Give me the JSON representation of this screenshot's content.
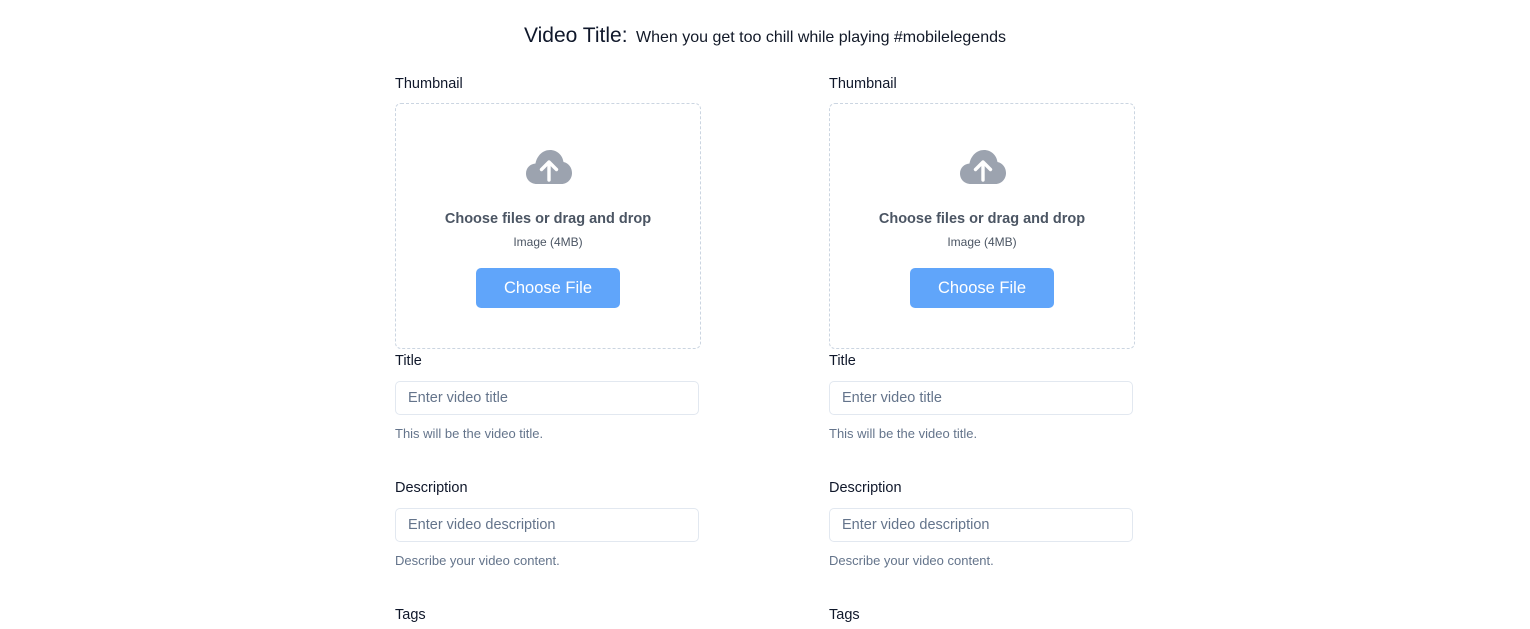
{
  "header": {
    "label": "Video Title:",
    "value": "When you get too chill while playing #mobilelegends"
  },
  "forms": [
    {
      "thumbnail_label": "Thumbnail",
      "dropzone": {
        "icon": "cloud-upload-icon",
        "main_text": "Choose files or drag and drop",
        "sub_text": "Image (4MB)",
        "button_label": "Choose File"
      },
      "title_label": "Title",
      "title_placeholder": "Enter video title",
      "title_helper": "This will be the video title.",
      "description_label": "Description",
      "description_placeholder": "Enter video description",
      "description_helper": "Describe your video content.",
      "tags_label": "Tags"
    },
    {
      "thumbnail_label": "Thumbnail",
      "dropzone": {
        "icon": "cloud-upload-icon",
        "main_text": "Choose files or drag and drop",
        "sub_text": "Image (4MB)",
        "button_label": "Choose File"
      },
      "title_label": "Title",
      "title_placeholder": "Enter video title",
      "title_helper": "This will be the video title.",
      "description_label": "Description",
      "description_placeholder": "Enter video description",
      "description_helper": "Describe your video content.",
      "tags_label": "Tags"
    }
  ],
  "colors": {
    "button_bg": "#60a5fa",
    "icon_gray": "#9ca3af",
    "border": "#e2e8f0",
    "helper_text": "#64748b"
  }
}
